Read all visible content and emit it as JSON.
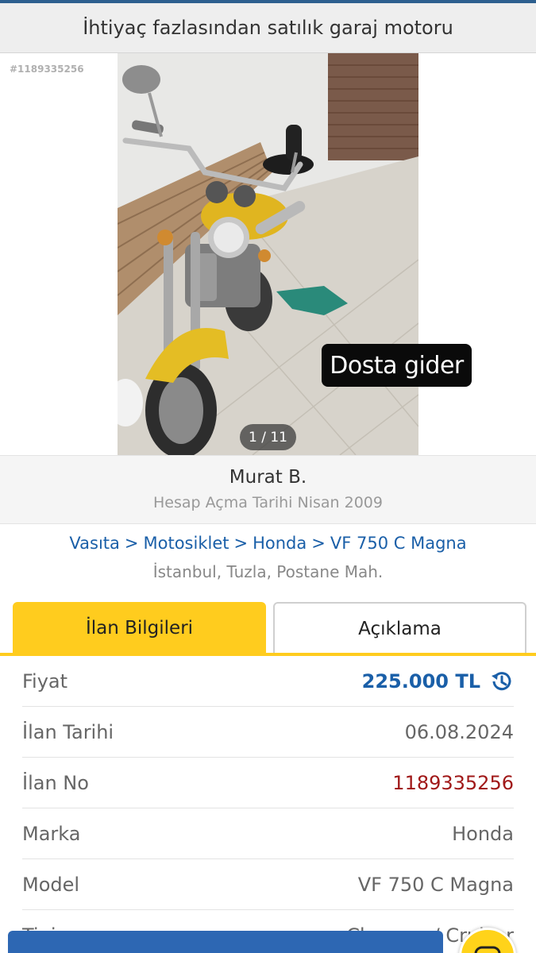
{
  "header": {
    "title": "İhtiyaç fazlasından satılık garaj motoru"
  },
  "listing": {
    "id_tag": "#1189335256",
    "photo_overlay_text": "Dosta gider",
    "photo_counter": "1 / 11"
  },
  "seller": {
    "name": "Murat B.",
    "since": "Hesap Açma Tarihi  Nisan 2009"
  },
  "breadcrumb": {
    "items": [
      "Vasıta",
      "Motosiklet",
      "Honda",
      "VF 750 C Magna"
    ],
    "separator": ">"
  },
  "location": "İstanbul, Tuzla, Postane Mah.",
  "tabs": [
    {
      "label": "İlan Bilgileri",
      "active": true
    },
    {
      "label": "Açıklama",
      "active": false
    }
  ],
  "details": [
    {
      "label": "Fiyat",
      "value": "225.000 TL"
    },
    {
      "label": "İlan Tarihi",
      "value": "06.08.2024"
    },
    {
      "label": "İlan No",
      "value": "1189335256"
    },
    {
      "label": "Marka",
      "value": "Honda"
    },
    {
      "label": "Model",
      "value": "VF 750 C Magna"
    },
    {
      "label": "Tipi",
      "value": "Chopper / Cruiser"
    }
  ],
  "icons": {
    "price_history": "history-icon",
    "chat": "chat-icon"
  },
  "colors": {
    "accent": "#ffcc1e",
    "link": "#1a5fa8",
    "id_red": "#a01818",
    "bar": "#2d67b3"
  }
}
